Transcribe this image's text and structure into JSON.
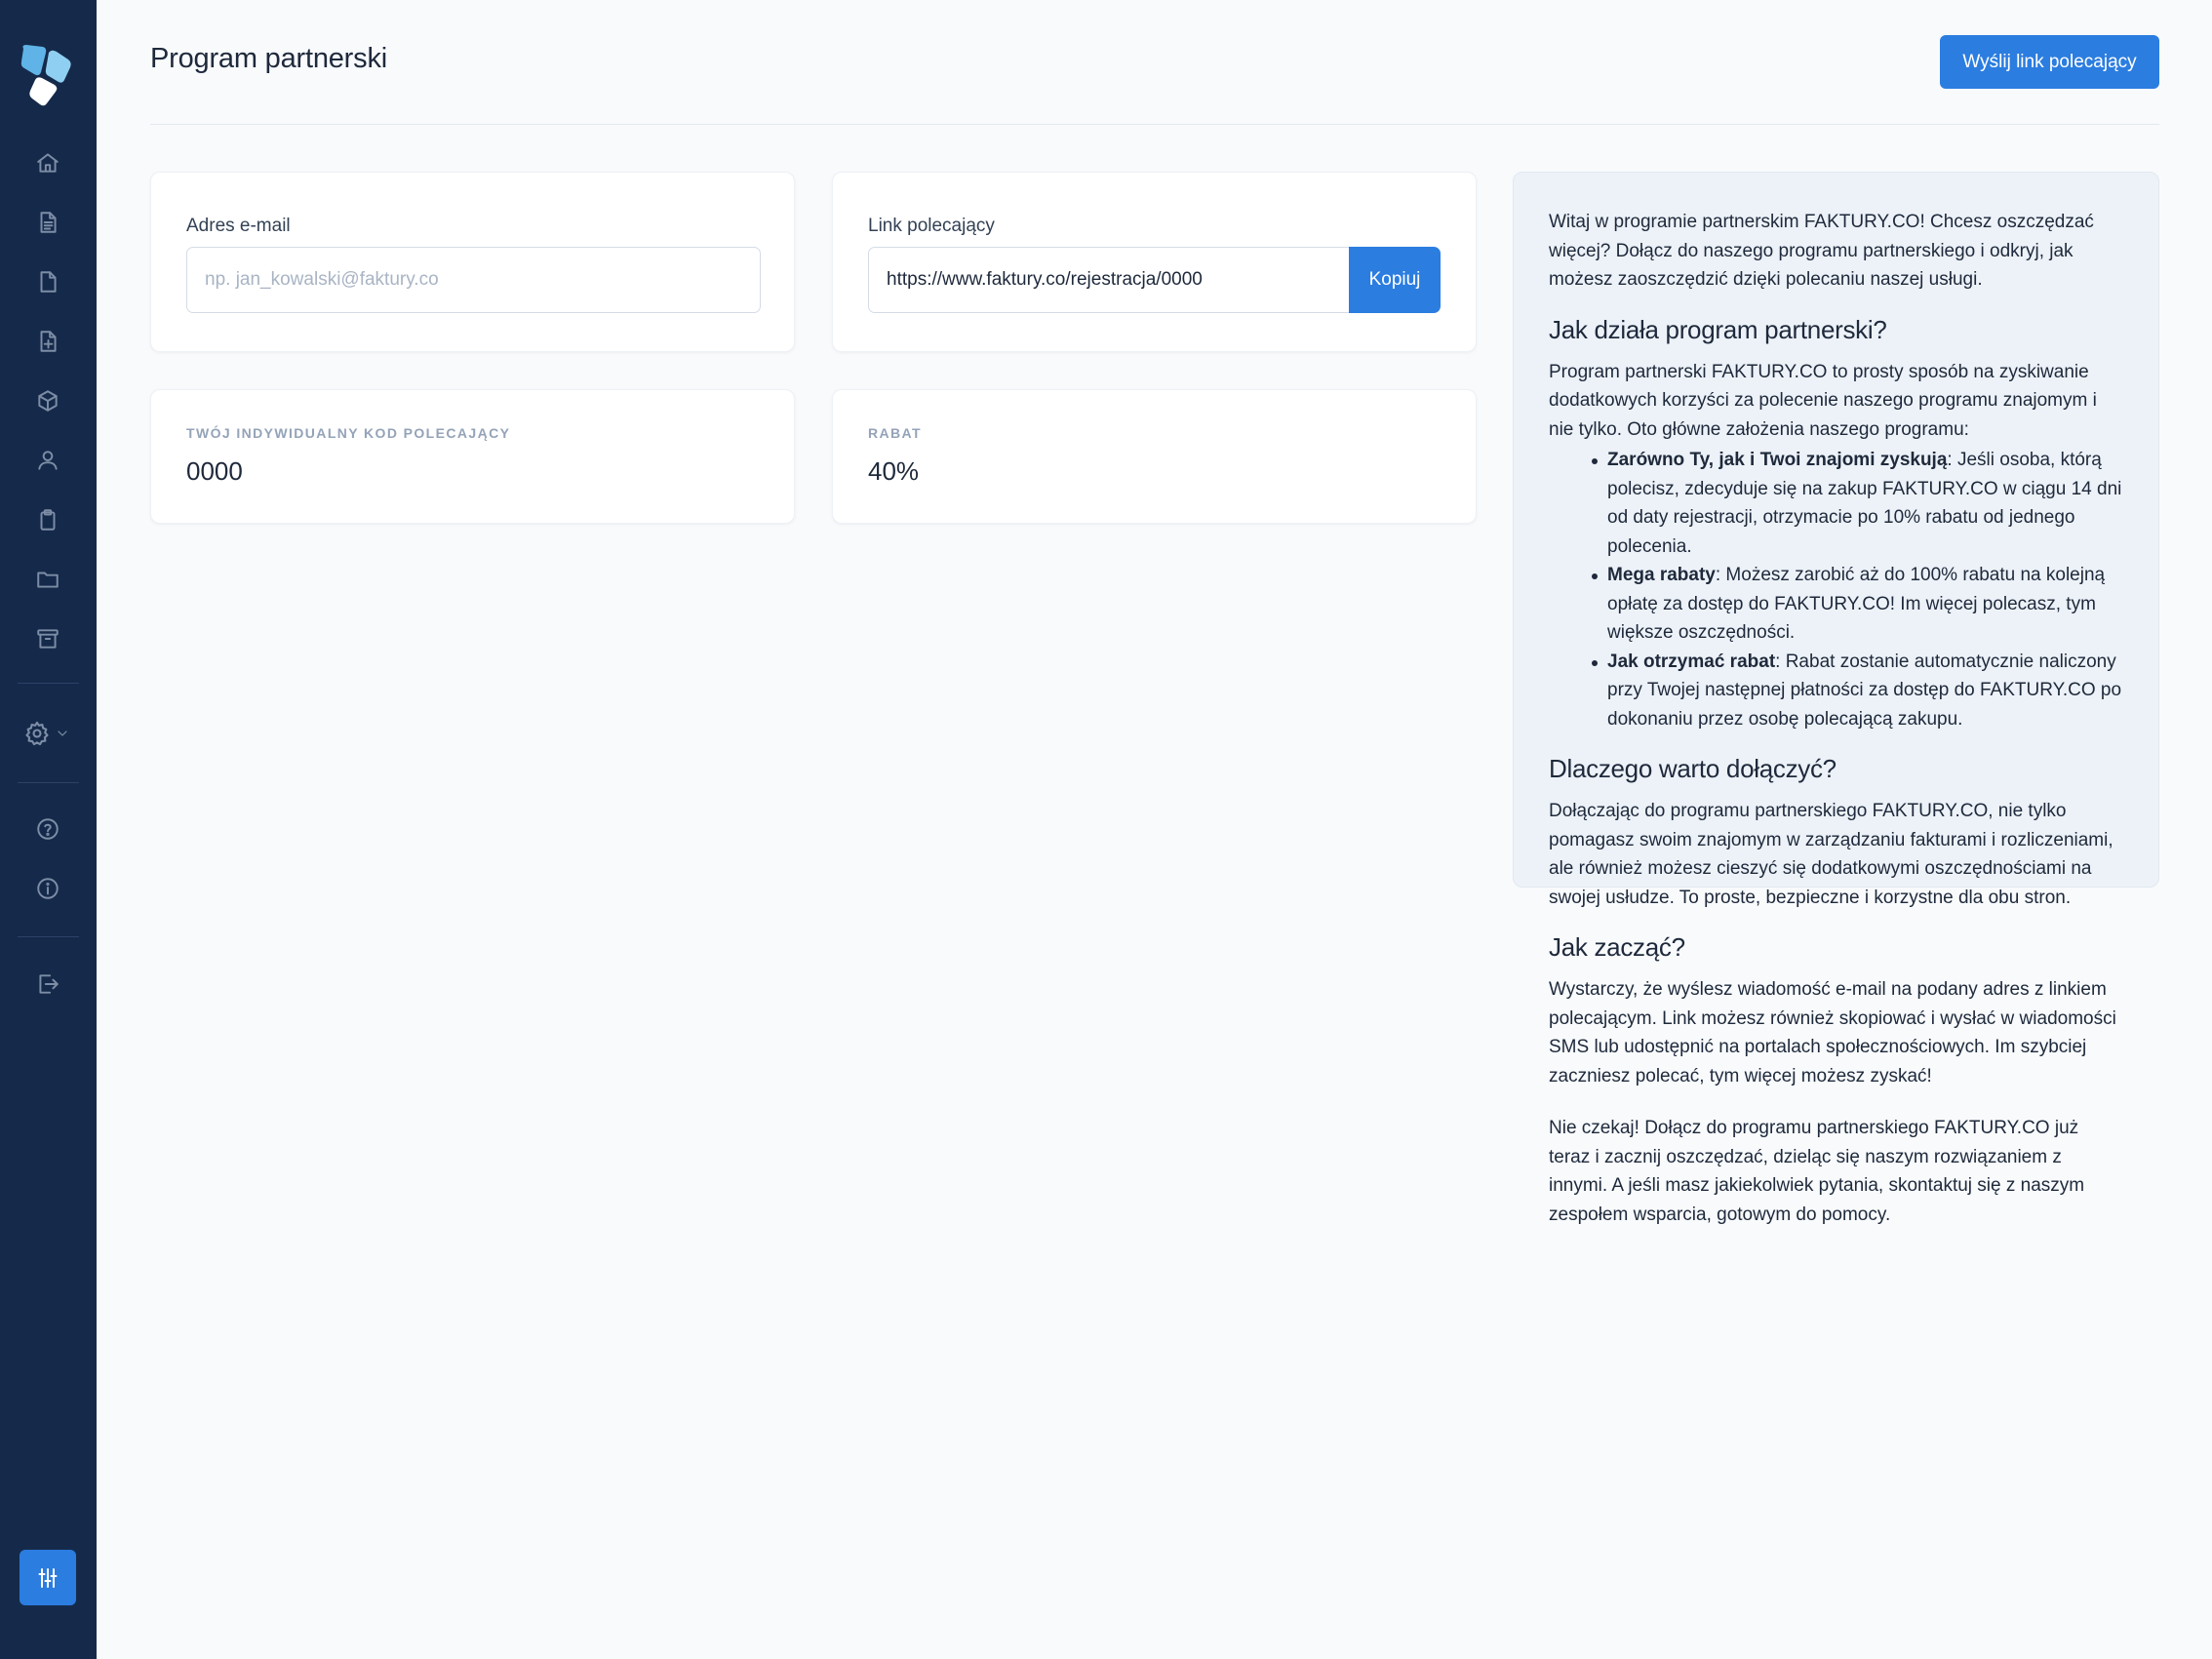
{
  "page": {
    "title": "Program partnerski",
    "send_button": "Wyślij link polecający"
  },
  "email_card": {
    "label": "Adres e-mail",
    "placeholder": "np. jan_kowalski@faktury.co",
    "value": ""
  },
  "link_card": {
    "label": "Link polecający",
    "value": "https://www.faktury.co/rejestracja/0000",
    "copy_button": "Kopiuj"
  },
  "code_card": {
    "label": "Twój indywidualny kod polecający",
    "value": "0000"
  },
  "discount_card": {
    "label": "Rabat",
    "value": "40%"
  },
  "sidebar": {
    "items": [
      {
        "icon": "home-icon"
      },
      {
        "icon": "document-text-icon"
      },
      {
        "icon": "document-icon"
      },
      {
        "icon": "document-add-icon"
      },
      {
        "icon": "cube-icon"
      },
      {
        "icon": "user-icon"
      },
      {
        "icon": "clipboard-icon"
      },
      {
        "icon": "folder-icon"
      },
      {
        "icon": "archive-icon"
      },
      {
        "icon": "gear-icon"
      },
      {
        "icon": "help-icon"
      },
      {
        "icon": "info-icon"
      },
      {
        "icon": "logout-icon"
      },
      {
        "icon": "adjustments-icon"
      }
    ]
  },
  "info": {
    "intro": "Witaj w programie partnerskim FAKTURY.CO! Chcesz oszczędzać więcej? Dołącz do naszego programu partnerskiego i odkryj, jak możesz zaoszczędzić dzięki polecaniu naszej usługi.",
    "h1": "Jak działa program partnerski?",
    "p1": "Program partnerski FAKTURY.CO to prosty sposób na zyskiwanie dodatkowych korzyści za polecenie naszego programu znajomym i nie tylko. Oto główne założenia naszego programu:",
    "bullets": [
      {
        "bold": "Zarówno Ty, jak i Twoi znajomi zyskują",
        "text": ": Jeśli osoba, którą polecisz, zdecyduje się na zakup FAKTURY.CO w ciągu 14 dni od daty rejestracji, otrzymacie po 10% rabatu od jednego polecenia."
      },
      {
        "bold": "Mega rabaty",
        "text": ": Możesz zarobić aż do 100% rabatu na kolejną opłatę za dostęp do FAKTURY.CO! Im więcej polecasz, tym większe oszczędności."
      },
      {
        "bold": "Jak otrzymać rabat",
        "text": ": Rabat zostanie automatycznie naliczony przy Twojej następnej płatności za dostęp do FAKTURY.CO po dokonaniu przez osobę polecającą zakupu."
      }
    ],
    "h2": "Dlaczego warto dołączyć?",
    "p2": "Dołączając do programu partnerskiego FAKTURY.CO, nie tylko pomagasz swoim znajomym w zarządzaniu fakturami i rozliczeniami, ale również możesz cieszyć się dodatkowymi oszczędnościami na swojej usłudze. To proste, bezpieczne i korzystne dla obu stron.",
    "h3": "Jak zacząć?",
    "p3": "Wystarczy, że wyślesz wiadomość e-mail na podany adres z linkiem polecającym. Link możesz również skopiować i wysłać w wiadomości SMS lub udostępnić na portalach społecznościowych. Im szybciej zaczniesz polecać, tym więcej możesz zyskać!",
    "p4": "Nie czekaj! Dołącz do programu partnerskiego FAKTURY.CO już teraz i zacznij oszczędzać, dzieląc się naszym rozwiązaniem z innymi. A jeśli masz jakiekolwiek pytania, skontaktuj się z naszym zespołem wsparcia, gotowym do pomocy."
  }
}
